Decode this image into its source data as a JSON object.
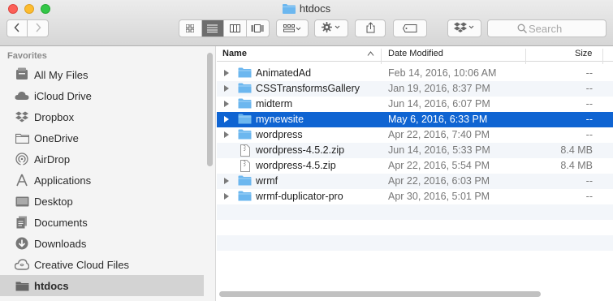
{
  "window": {
    "title": "htdocs"
  },
  "search": {
    "placeholder": "Search"
  },
  "sidebar": {
    "heading": "Favorites",
    "items": [
      {
        "label": "All My Files",
        "icon": "all-files-icon"
      },
      {
        "label": "iCloud Drive",
        "icon": "cloud-icon"
      },
      {
        "label": "Dropbox",
        "icon": "dropbox-icon"
      },
      {
        "label": "OneDrive",
        "icon": "folder-icon"
      },
      {
        "label": "AirDrop",
        "icon": "airdrop-icon"
      },
      {
        "label": "Applications",
        "icon": "applications-icon"
      },
      {
        "label": "Desktop",
        "icon": "desktop-icon"
      },
      {
        "label": "Documents",
        "icon": "documents-icon"
      },
      {
        "label": "Downloads",
        "icon": "downloads-icon"
      },
      {
        "label": "Creative Cloud Files",
        "icon": "creative-cloud-icon"
      },
      {
        "label": "htdocs",
        "icon": "folder-icon",
        "selected": true
      }
    ]
  },
  "columns": {
    "name": "Name",
    "date": "Date Modified",
    "size": "Size"
  },
  "files": [
    {
      "name": "AnimatedAd",
      "date": "Feb 14, 2016, 10:06 AM",
      "size": "--",
      "kind": "folder"
    },
    {
      "name": "CSSTransformsGallery",
      "date": "Jan 19, 2016, 8:37 PM",
      "size": "--",
      "kind": "folder"
    },
    {
      "name": "midterm",
      "date": "Jun 14, 2016, 6:07 PM",
      "size": "--",
      "kind": "folder"
    },
    {
      "name": "mynewsite",
      "date": "May 6, 2016, 6:33 PM",
      "size": "--",
      "kind": "folder",
      "selected": true
    },
    {
      "name": "wordpress",
      "date": "Apr 22, 2016, 7:40 PM",
      "size": "--",
      "kind": "folder"
    },
    {
      "name": "wordpress-4.5.2.zip",
      "date": "Jun 14, 2016, 5:33 PM",
      "size": "8.4 MB",
      "kind": "zip"
    },
    {
      "name": "wordpress-4.5.zip",
      "date": "Apr 22, 2016, 5:54 PM",
      "size": "8.4 MB",
      "kind": "zip"
    },
    {
      "name": "wrmf",
      "date": "Apr 22, 2016, 6:03 PM",
      "size": "--",
      "kind": "folder"
    },
    {
      "name": "wrmf-duplicator-pro",
      "date": "Apr 30, 2016, 5:01 PM",
      "size": "--",
      "kind": "folder"
    }
  ],
  "colors": {
    "selection": "#0f64d2",
    "folder": "#6cb7ef",
    "sidebar_selection": "#d3d3d3"
  }
}
